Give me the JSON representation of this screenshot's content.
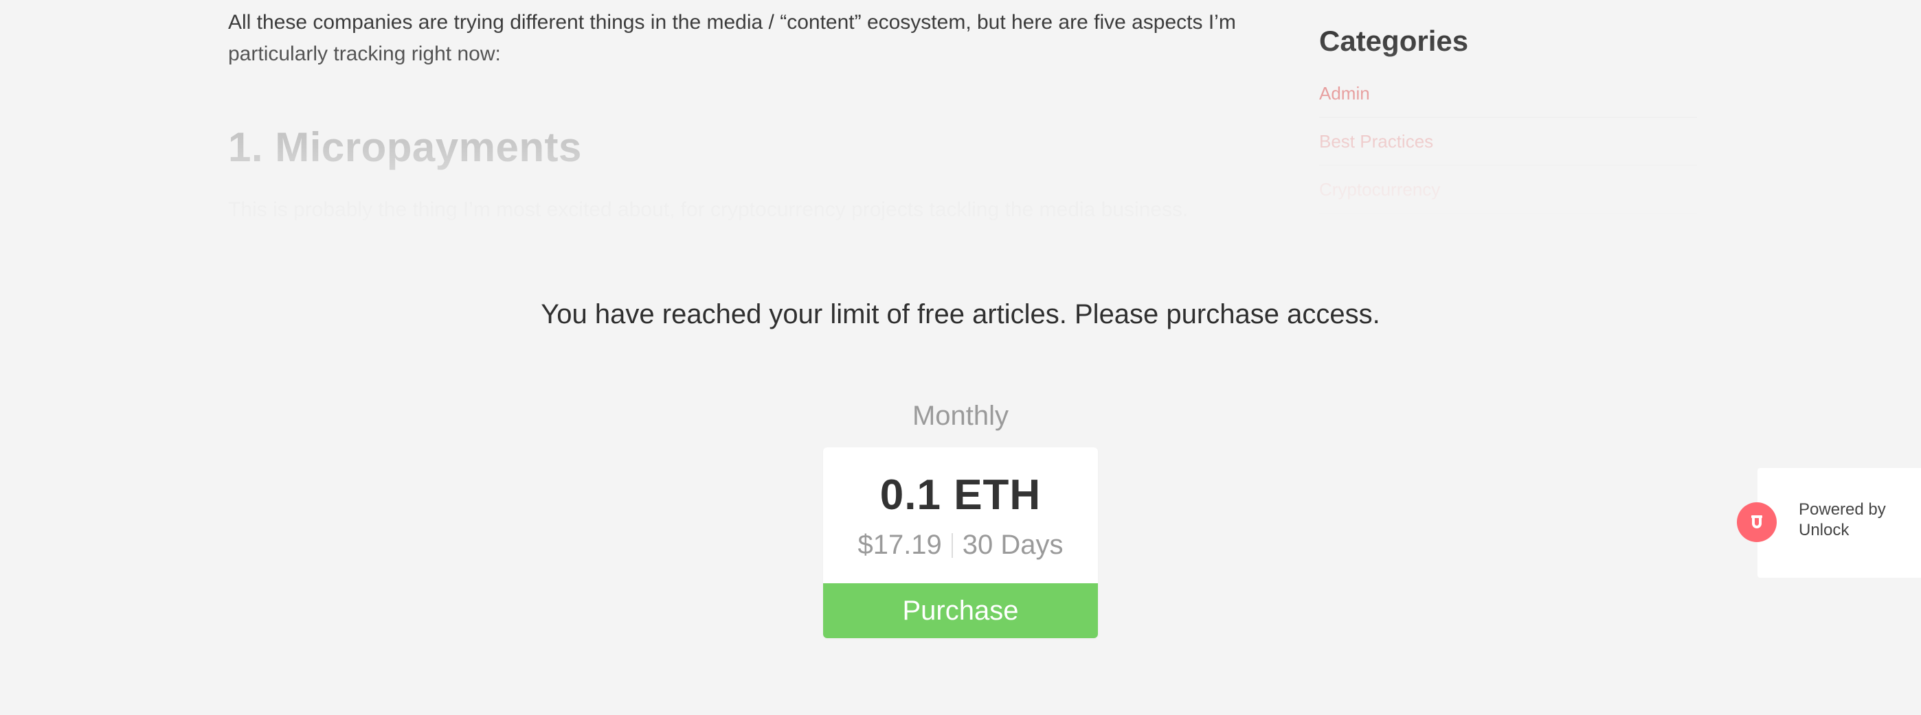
{
  "article": {
    "intro": "All these companies are trying different things in the media / “content” ecosystem, but here are five aspects I’m particularly tracking right now:",
    "heading": "1. Micropayments",
    "paragraph": "This is probably the thing I’m most excited about, for cryptocurrency projects tackling the media business."
  },
  "sidebar": {
    "title": "Categories",
    "categories": [
      {
        "label": "Admin"
      },
      {
        "label": "Best Practices"
      },
      {
        "label": "Cryptocurrency"
      },
      {
        "label": ""
      }
    ]
  },
  "paywall": {
    "message": "You have reached your limit of free articles. Please purchase access.",
    "plan": {
      "label": "Monthly",
      "price": "0.1 ETH",
      "fiat_price": "$17.19",
      "duration": "30 Days",
      "button_label": "Purchase"
    }
  },
  "unlock_widget": {
    "powered_by_line1": "Powered by",
    "powered_by_line2": "Unlock",
    "icon": "unlock-logo-icon"
  },
  "colors": {
    "background": "#f4f4f4",
    "accent_link": "#e07070",
    "purchase_green": "#74d063",
    "unlock_red": "#ff6771"
  }
}
